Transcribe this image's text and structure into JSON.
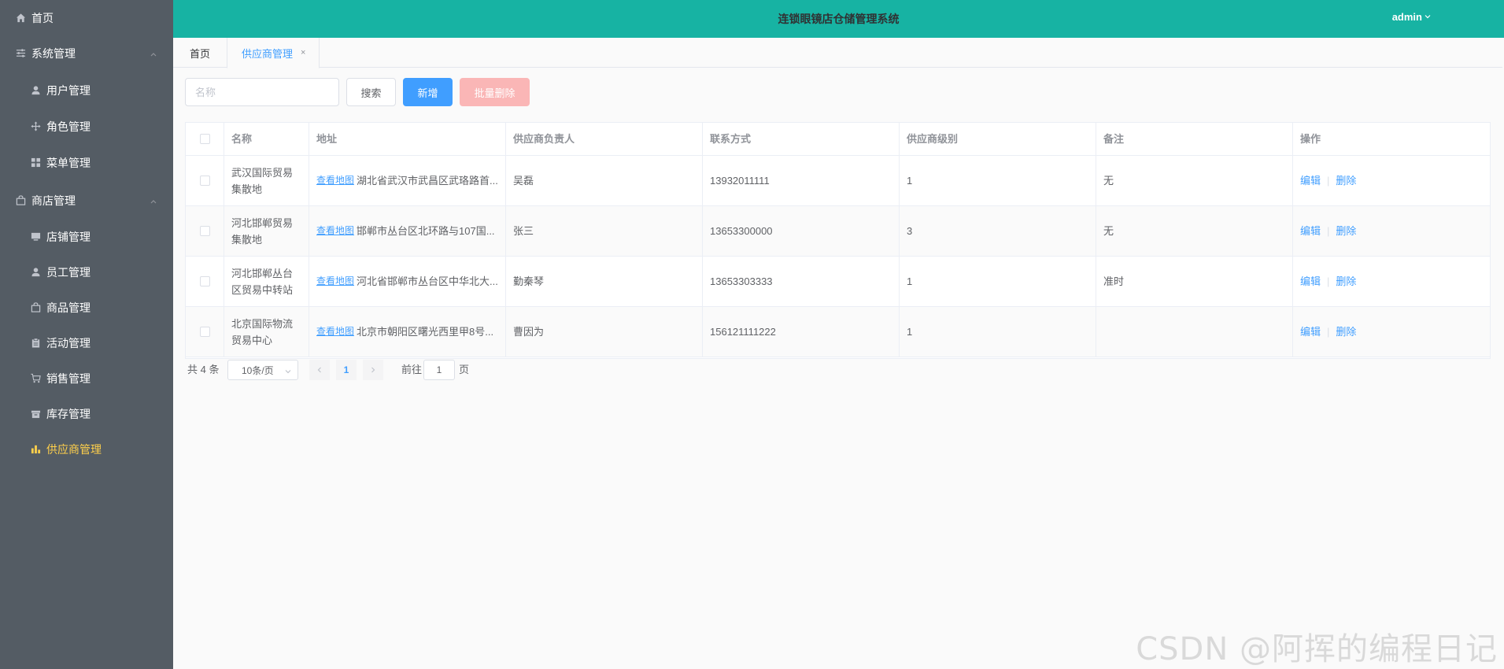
{
  "sidebar": {
    "home": "首页",
    "system": "系统管理",
    "users": "用户管理",
    "roles": "角色管理",
    "menus": "菜单管理",
    "shop": "商店管理",
    "stores": "店铺管理",
    "employees": "员工管理",
    "goods": "商品管理",
    "activities": "活动管理",
    "sales": "销售管理",
    "inventory": "库存管理",
    "suppliers": "供应商管理"
  },
  "header": {
    "title": "连锁眼镜店仓储管理系统",
    "user": "admin"
  },
  "tabs": {
    "home": "首页",
    "current": "供应商管理",
    "close": "×"
  },
  "toolbar": {
    "name_placeholder": "名称",
    "name_value": "",
    "search": "搜索",
    "add": "新增",
    "batch_delete": "批量删除"
  },
  "table": {
    "columns": [
      "名称",
      "地址",
      "供应商负责人",
      "联系方式",
      "供应商级别",
      "备注",
      "操作"
    ],
    "map_link": "查看地图",
    "edit": "编辑",
    "delete": "删除",
    "rows": [
      {
        "name": "武汉国际贸易集散地",
        "address": "湖北省武汉市武昌区武珞路首...",
        "manager": "吴磊",
        "phone": "13932011111",
        "level": "1",
        "remark": "无"
      },
      {
        "name": "河北邯郸贸易集散地",
        "address": "邯郸市丛台区北环路与107国...",
        "manager": "张三",
        "phone": "13653300000",
        "level": "3",
        "remark": "无"
      },
      {
        "name": "河北邯郸丛台区贸易中转站",
        "address": "河北省邯郸市丛台区中华北大...",
        "manager": "勤秦琴",
        "phone": "13653303333",
        "level": "1",
        "remark": "准时"
      },
      {
        "name": "北京国际物流贸易中心",
        "address": "北京市朝阳区曙光西里甲8号...",
        "manager": "曹因为",
        "phone": "156121111222",
        "level": "1",
        "remark": ""
      }
    ]
  },
  "pagination": {
    "total": "共 4 条",
    "page_size": "10条/页",
    "current_page": "1",
    "goto_label": "前往",
    "goto_value": "1",
    "page_suffix": "页"
  },
  "watermark": "CSDN @阿挥的编程日记",
  "colors": {
    "sidebar_bg": "#545c64",
    "header_bg": "#17b3a3",
    "active_menu": "#ffd04b",
    "primary": "#409eff",
    "danger_light": "#fab6b6"
  }
}
